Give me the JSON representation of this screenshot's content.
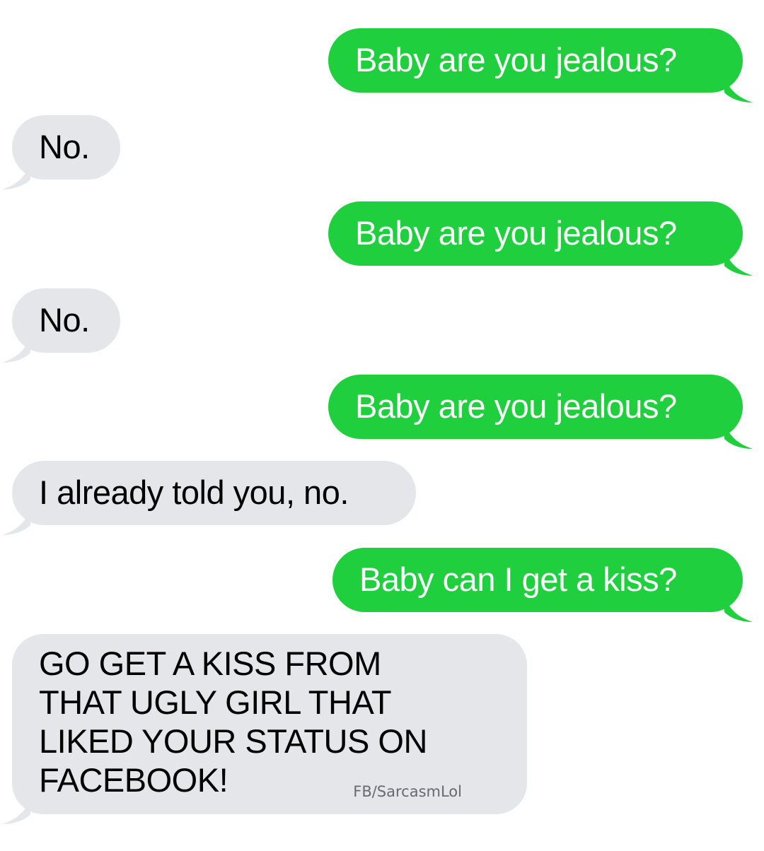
{
  "conversation": {
    "messages": [
      {
        "sender": "me",
        "text": "Baby are you jealous?"
      },
      {
        "sender": "them",
        "text": "No."
      },
      {
        "sender": "me",
        "text": "Baby are you jealous?"
      },
      {
        "sender": "them",
        "text": "No."
      },
      {
        "sender": "me",
        "text": "Baby are you jealous?"
      },
      {
        "sender": "them",
        "text": "I already told you, no."
      },
      {
        "sender": "me",
        "text": "Baby can I get a kiss?"
      },
      {
        "sender": "them",
        "lines": [
          "GO GET A KISS FROM",
          "THAT UGLY GIRL THAT",
          "LIKED YOUR STATUS ON",
          "FACEBOOK!"
        ]
      }
    ]
  },
  "watermark": "FB/SarcasmLol",
  "colors": {
    "sent_bubble": "#1fcf3d",
    "received_bubble": "#e5e6ea",
    "sent_text": "#ffffff",
    "received_text": "#000000"
  }
}
